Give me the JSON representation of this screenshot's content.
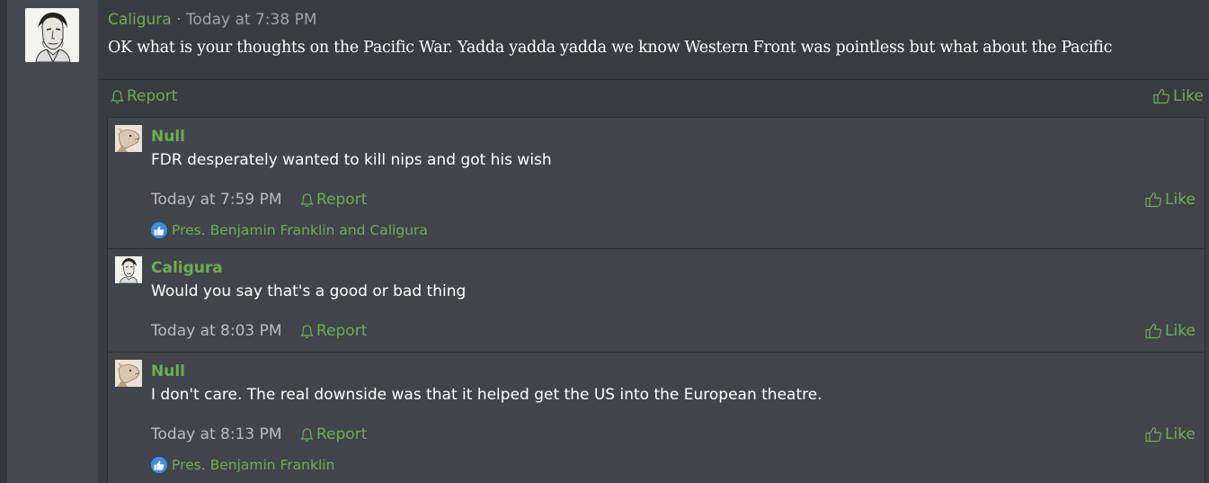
{
  "post": {
    "username": "Caligura",
    "separator": " · ",
    "timestamp": "Today at 7:38 PM",
    "message": "OK what is your thoughts on the Pacific War. Yadda yadda yadda we know Western Front was pointless but what about the Pacific",
    "report_label": "Report",
    "like_label": "Like"
  },
  "comments": [
    {
      "username": "Null",
      "text": "FDR desperately wanted to kill nips and got his wish",
      "timestamp": "Today at 7:59 PM",
      "report_label": "Report",
      "like_label": "Like",
      "reactions": "Pres. Benjamin Franklin and Caligura"
    },
    {
      "username": "Caligura",
      "text": "Would you say that's a good or bad thing",
      "timestamp": "Today at 8:03 PM",
      "report_label": "Report",
      "like_label": "Like"
    },
    {
      "username": "Null",
      "text": "I don't care. The real downside was that it helped get the US into the European theatre.",
      "timestamp": "Today at 8:13 PM",
      "report_label": "Report",
      "like_label": "Like",
      "reactions": "Pres. Benjamin Franklin"
    }
  ],
  "colors": {
    "accent": "#6ab04c",
    "background": "#383b41",
    "comment_background": "#41444b",
    "reaction_badge": "#3b8fe6"
  },
  "icons": {
    "report": "bell-icon",
    "like": "thumbs-up-icon",
    "reaction": "like-reaction-icon"
  }
}
